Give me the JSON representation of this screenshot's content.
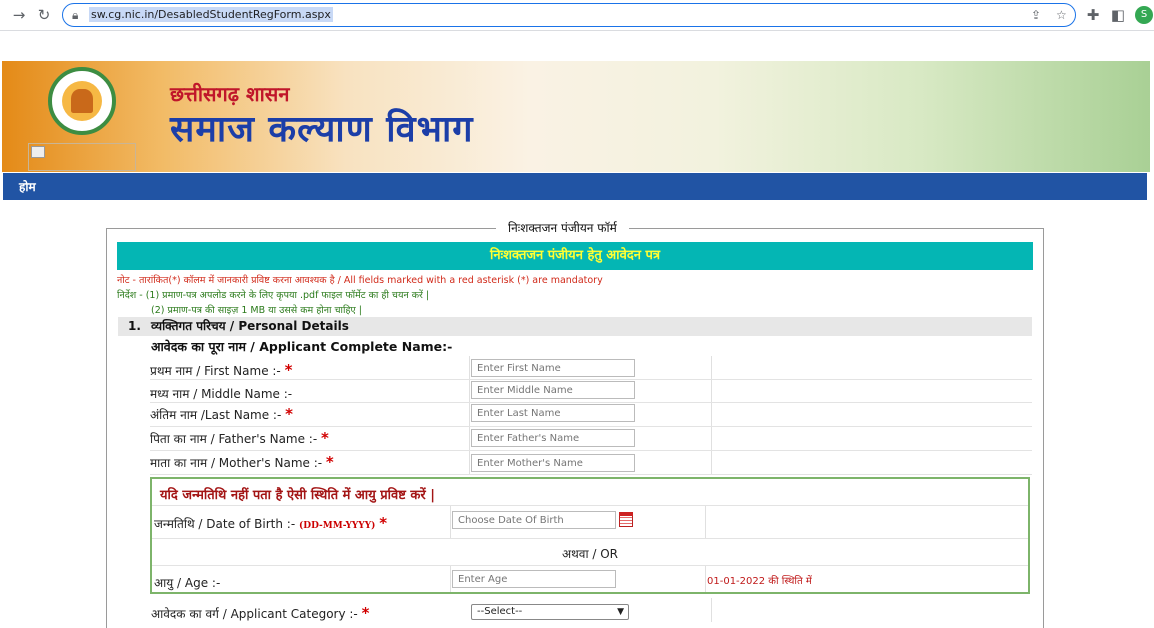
{
  "browser": {
    "url": "sw.cg.nic.in/DesabledStudentRegForm.aspx",
    "icons": [
      "forward-icon",
      "reload-icon",
      "lock-icon",
      "share-icon",
      "star-icon",
      "extensions-icon",
      "sidepanel-icon"
    ],
    "profile_initial": "S"
  },
  "banner": {
    "gov_title": "छत्तीसगढ़ शासन",
    "dept_title": "समाज कल्याण विभाग"
  },
  "nav": {
    "home": "होम"
  },
  "form": {
    "legend": "निःशक्तजन पंजीयन फॉर्म",
    "title": "निःशक्तजन पंजीयन हेतु आवेदन पत्र",
    "note": "नोट - तारांकित(*) कॉलम में जानकारी प्रविष्ट करना आवश्यक है / All fields marked with a red asterisk (*) are mandatory",
    "instruction1": "निर्देश - (1) प्रमाण-पत्र अपलोड करने के लिए कृपया .pdf फाइल फॉर्मेट का ही चयन करें |",
    "instruction2": "(2) प्रमाण-पत्र की साइज़ 1 MB या उससे कम होना चाहिए |",
    "section_number": "1.",
    "section_title": "व्यक्तिगत परिचय / Personal Details",
    "name_heading": "आवेदक का पूरा नाम / Applicant Complete Name:-",
    "fields": [
      {
        "label": "प्रथम नाम / First Name :-",
        "placeholder": "Enter First Name",
        "required": "*"
      },
      {
        "label": "मध्य नाम / Middle Name :-",
        "placeholder": "Enter Middle Name",
        "required": ""
      },
      {
        "label": "अंतिम नाम /Last Name :-",
        "placeholder": "Enter Last Name",
        "required": "*"
      },
      {
        "label": "पिता का नाम / Father's Name :-",
        "placeholder": "Enter Father's Name",
        "required": "*"
      },
      {
        "label": "माता का नाम / Mother's Name :-",
        "placeholder": "Enter Mother's Name",
        "required": "*"
      }
    ],
    "dob_section": {
      "heading": "यदि जन्मतिथि नहीं पता है ऐसी स्थिति में आयु प्रविष्ट करें |",
      "dob_label": "जन्मतिथि / Date of Birth :-",
      "dob_format": "(DD-MM-YYYY)",
      "dob_required": "*",
      "dob_placeholder": "Choose Date Of Birth",
      "or_text": "अथवा / OR",
      "age_label": "आयु / Age :-",
      "age_placeholder": "Enter Age",
      "age_note": "01-01-2022  की स्थिति में"
    },
    "category": {
      "label": "आवेदक का वर्ग / Applicant Category :-",
      "required": "*",
      "selected": "--Select--"
    }
  },
  "colors": {
    "nav_blue": "#2154a4",
    "title_teal": "#04b6b4",
    "title_text": "#ffff33",
    "required_red": "#d10000",
    "dob_border": "#7db46a"
  }
}
